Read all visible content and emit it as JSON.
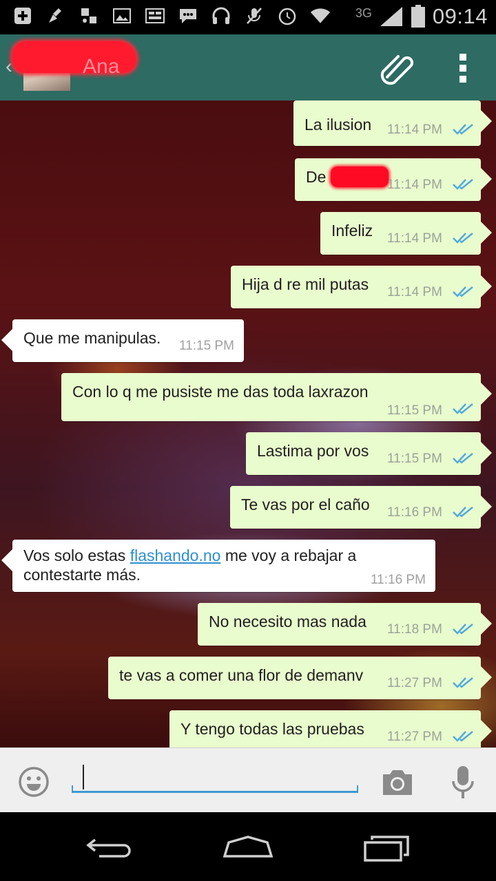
{
  "status_bar": {
    "network": "3G",
    "time": "09:14",
    "icons": [
      "add-icon",
      "cleaner-icon",
      "media-icon",
      "gallery-icon",
      "bbm-icon",
      "chat-icon",
      "headphones-icon",
      "mute-icon",
      "alarm-icon",
      "wifi-icon",
      "signal-icon",
      "battery-icon"
    ]
  },
  "header": {
    "contact_name_visible": "Ana",
    "icons": [
      "back-icon",
      "attach-icon",
      "overflow-menu-icon"
    ]
  },
  "messages": [
    {
      "dir": "out",
      "text": "La ilusion",
      "time": "11:14 PM"
    },
    {
      "dir": "out",
      "text": "De u",
      "time": "11:14 PM"
    },
    {
      "dir": "out",
      "text": "Infeliz",
      "time": "11:14 PM"
    },
    {
      "dir": "out",
      "text": "Hija d re mil putas",
      "time": "11:14 PM"
    },
    {
      "dir": "in",
      "text": "Que me manipulas.",
      "time": "11:15 PM"
    },
    {
      "dir": "out",
      "text": "Con lo q me pusiste me das toda laxrazon",
      "time": "11:15 PM"
    },
    {
      "dir": "out",
      "text": "Lastima por vos",
      "time": "11:15 PM"
    },
    {
      "dir": "out",
      "text": "Te vas por el caño",
      "time": "11:16 PM"
    },
    {
      "dir": "in",
      "text_before": "Vos solo estas ",
      "link": "flashando.no",
      "text_after": " me voy a rebajar a",
      "text_line2": "contestarte más.",
      "time": "11:16 PM"
    },
    {
      "dir": "out",
      "text": "No necesito mas nada",
      "time": "11:18 PM"
    },
    {
      "dir": "out",
      "text": "te vas a comer una flor de demanv",
      "time": "11:27 PM"
    },
    {
      "dir": "out",
      "text": "Y tengo todas las pruebas",
      "time": "11:27 PM"
    }
  ],
  "input": {
    "value": "",
    "placeholder": ""
  },
  "colors": {
    "header": "#2d6b63",
    "outgoing_bubble": "#e9fccd",
    "incoming_bubble": "#ffffff",
    "read_ticks": "#4fa9e0",
    "input_underline": "#3c9ad0"
  }
}
